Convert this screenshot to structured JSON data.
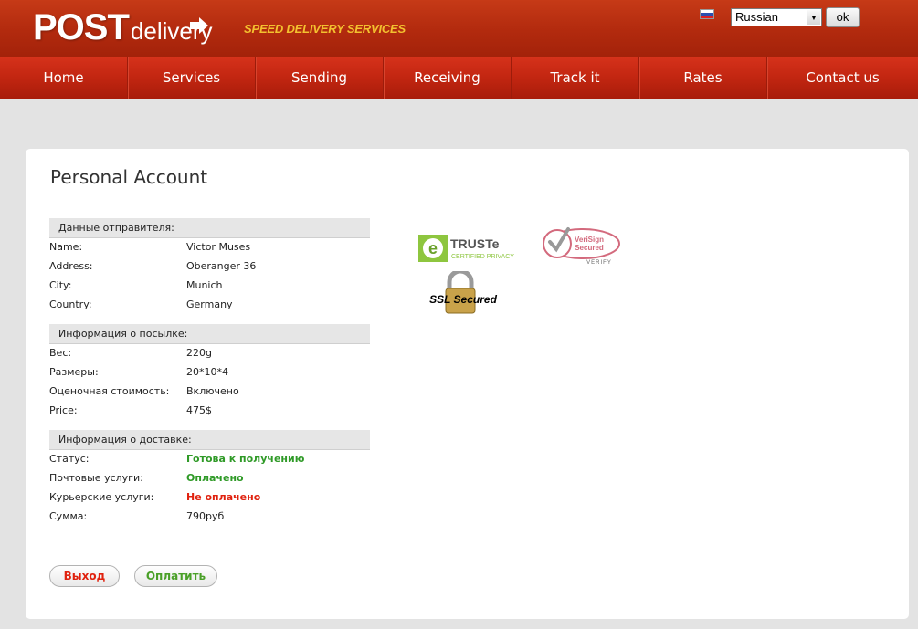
{
  "header": {
    "logo_main": "POST",
    "logo_sub": "delivery",
    "tagline": "SPEED DELIVERY SERVICES",
    "language_selected": "Russian",
    "ok_label": "ok"
  },
  "nav": {
    "items": [
      {
        "label": "Home"
      },
      {
        "label": "Services"
      },
      {
        "label": "Sending"
      },
      {
        "label": "Receiving"
      },
      {
        "label": "Track it"
      },
      {
        "label": "Rates"
      },
      {
        "label": "Contact us"
      }
    ]
  },
  "page": {
    "title": "Personal Account"
  },
  "sender": {
    "heading": "Данные отправителя:",
    "rows": [
      {
        "label": "Name:",
        "value": "Victor Muses"
      },
      {
        "label": "Address:",
        "value": "Oberanger 36"
      },
      {
        "label": "City:",
        "value": "Munich"
      },
      {
        "label": "Country:",
        "value": "Germany"
      }
    ]
  },
  "parcel": {
    "heading": "Информация о посылке:",
    "rows": [
      {
        "label": "Вес:",
        "value": "220g"
      },
      {
        "label": "Размеры:",
        "value": "20*10*4"
      },
      {
        "label": "Оценочная стоимость:",
        "value": "Включено"
      },
      {
        "label": "Price:",
        "value": "475$"
      }
    ]
  },
  "delivery": {
    "heading": "Информация о доставке:",
    "rows": [
      {
        "label": "Статус:",
        "value": "Готова к получению"
      },
      {
        "label": "Почтовые услуги:",
        "value": "Оплачено"
      },
      {
        "label": "Курьерские услуги:",
        "value": "Не оплачено"
      },
      {
        "label": "Сумма:",
        "value": "790руб"
      }
    ]
  },
  "actions": {
    "exit_label": "Выход",
    "pay_label": "Оплатить"
  },
  "badges": {
    "truste_title": "TRUSTe",
    "truste_sub": "CERTIFIED PRIVACY",
    "verisign_line1": "VeriSign",
    "verisign_line2": "Secured",
    "verisign_verify": "VERIFY",
    "ssl_label": "SSL Secured"
  },
  "colors": {
    "brand_red": "#b22a0e",
    "tagline_yellow": "#f3c12f",
    "status_green": "#2f9a27",
    "status_red": "#e0220f"
  }
}
